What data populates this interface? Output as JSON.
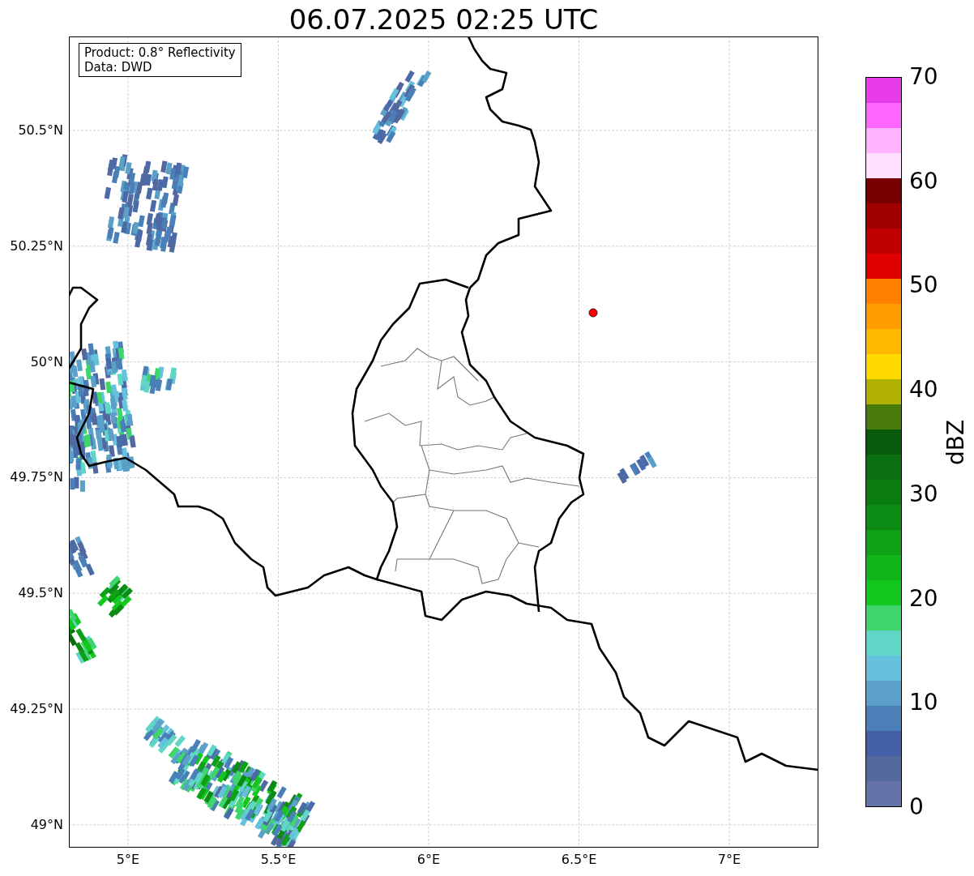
{
  "title": "06.07.2025 02:25 UTC",
  "info": [
    "Product: 0.8° Reflectivity",
    "Data: DWD"
  ],
  "x_ticks": [
    "5°E",
    "5.5°E",
    "6°E",
    "6.5°E",
    "7°E"
  ],
  "y_ticks": [
    "50.5°N",
    "50.25°N",
    "50°N",
    "49.75°N",
    "49.5°N",
    "49.25°N",
    "49°N"
  ],
  "colorbar": {
    "label": "dBZ",
    "ticks": [
      "70",
      "60",
      "50",
      "40",
      "30",
      "20",
      "10",
      "0"
    ],
    "bins": [
      {
        "color": "#e83ce8"
      },
      {
        "color": "#ff66ff"
      },
      {
        "color": "#ffb3ff"
      },
      {
        "color": "#ffe0ff"
      },
      {
        "color": "#780000"
      },
      {
        "color": "#a00000"
      },
      {
        "color": "#c00000"
      },
      {
        "color": "#e00000"
      },
      {
        "color": "#ff7f00"
      },
      {
        "color": "#ff9c00"
      },
      {
        "color": "#ffb800"
      },
      {
        "color": "#ffd800"
      },
      {
        "color": "#b0b000"
      },
      {
        "color": "#4a7a0a"
      },
      {
        "color": "#065a0a"
      },
      {
        "color": "#0a700f"
      },
      {
        "color": "#0a7c12"
      },
      {
        "color": "#0c8c14"
      },
      {
        "color": "#0ea016"
      },
      {
        "color": "#10b418"
      },
      {
        "color": "#12c81c"
      },
      {
        "color": "#3ed56c"
      },
      {
        "color": "#5fd6c6"
      },
      {
        "color": "#66c2dc"
      },
      {
        "color": "#5aa0c8"
      },
      {
        "color": "#4a7fb8"
      },
      {
        "color": "#4460a8"
      },
      {
        "color": "#5468a0"
      },
      {
        "color": "#6474a8"
      }
    ]
  }
}
